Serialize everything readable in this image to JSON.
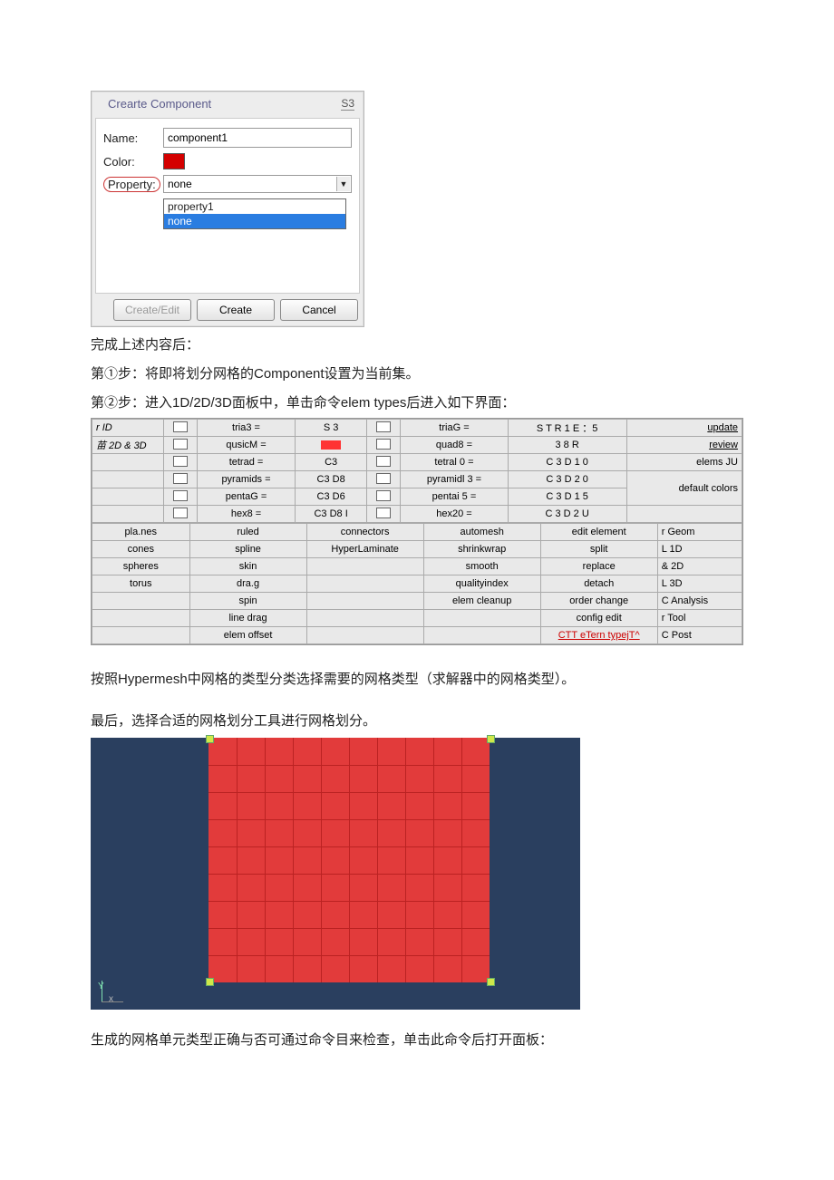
{
  "dialog": {
    "title": "Crearte Component",
    "corner": "S3",
    "labels": {
      "name": "Name:",
      "color": "Color:",
      "property": "Property:"
    },
    "name_value": "component1",
    "property_value": "none",
    "options": [
      "property1",
      "none"
    ],
    "buttons": {
      "create_edit": "Create/Edit",
      "create": "Create",
      "cancel": "Cancel"
    }
  },
  "text": {
    "p1": "完成上述内容后：",
    "p2": "第①步：将即将划分网格的Component设置为当前集。",
    "p3": "第②步：进入1D/2D/3D面板中，单击命令elem types后进入如下界面：",
    "p4": "按照Hypermesh中网格的类型分类选择需要的网格类型（求解器中的网格类型）。",
    "p5": "最后，选择合适的网格划分工具进行网格划分。",
    "p6": "生成的网格单元类型正确与否可通过命令目来检查，单击此命令后打开面板："
  },
  "panel": {
    "leftcol_head": [
      "r ID",
      "苗 2D & 3D"
    ],
    "col1": [
      "tria3 =",
      "qusicM =",
      "tetrad =",
      "pyramids =",
      "pentaG =",
      "hex8 ="
    ],
    "col2": [
      "S 3",
      "",
      "C3",
      "C3 D8",
      "C3 D6",
      "C3 D8 I"
    ],
    "col3": [
      "triaG =",
      "quad8 =",
      "tetral 0 =",
      "pyramidl 3 =",
      "pentai 5 =",
      "hex20 ="
    ],
    "col4": [
      "S T R 1 E ：5",
      "3 8 R",
      "C 3 D 1 0",
      "C 3 D 2 0",
      "C 3 D 1 5",
      "C 3 D 2 U"
    ],
    "rightcol": [
      "update",
      "review",
      "elems JU",
      "",
      "default colors",
      ""
    ],
    "row2": {
      "c1": [
        "pla.nes",
        "cones",
        "spheres",
        "torus",
        "",
        "",
        ""
      ],
      "c2": [
        "ruled",
        "spline",
        "skin",
        "dra.g",
        "spin",
        "line drag",
        "elem offset"
      ],
      "c3": [
        "connectors",
        "HyperLaminate",
        "",
        "",
        "",
        "",
        ""
      ],
      "c4": [
        "automesh",
        "shrinkwrap",
        "smooth",
        "qualityindex",
        "elem cleanup",
        "",
        ""
      ],
      "c5": [
        "edit element",
        "split",
        "replace",
        "detach",
        "order change",
        "config edit",
        "CTT eTern typejT^"
      ],
      "c6": [
        "r Geom",
        "L 1D",
        "& 2D",
        "L 3D",
        "C Analysis",
        "r Tool",
        "C Post"
      ]
    }
  }
}
